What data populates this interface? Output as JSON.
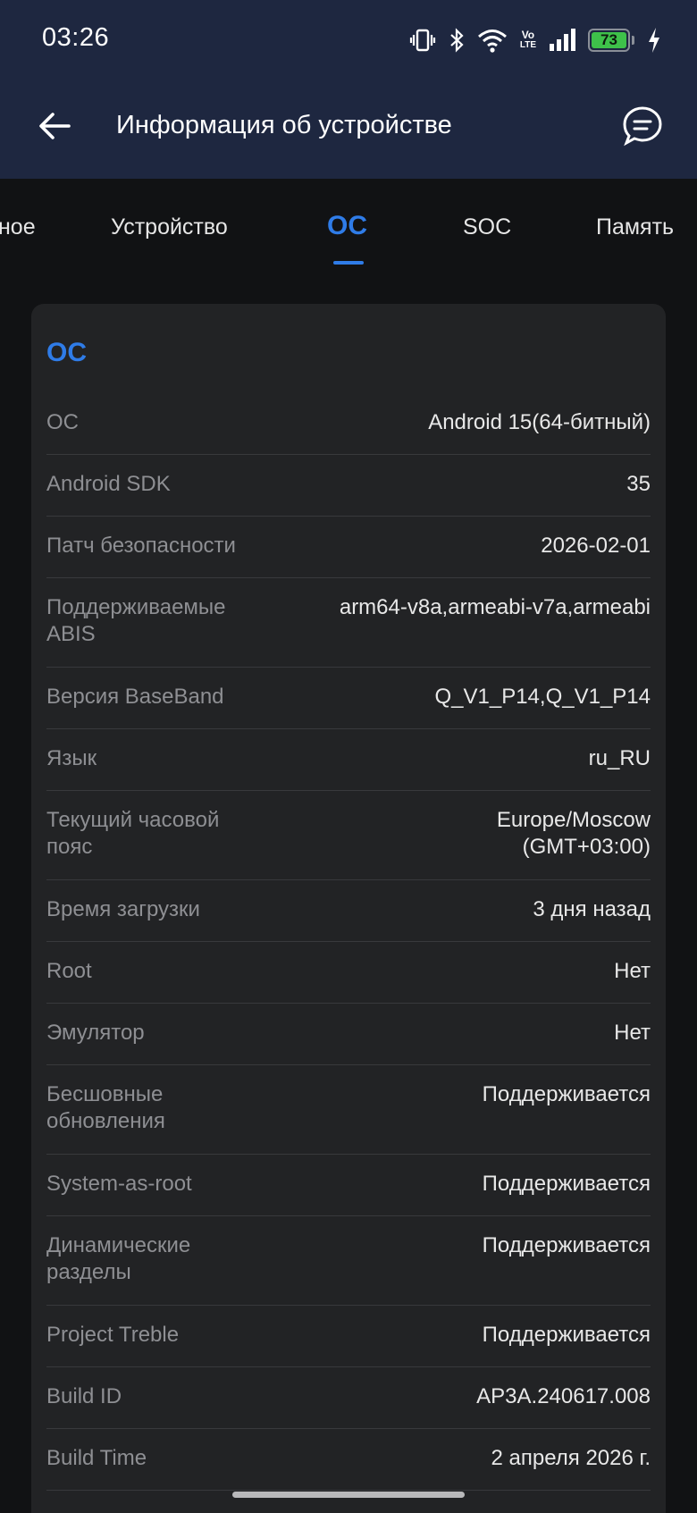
{
  "status_bar": {
    "time": "03:26",
    "battery_level": "73",
    "network_label_top": "Vo",
    "network_label_bottom": "LTE",
    "icons": [
      "vibrate-icon",
      "bluetooth-icon",
      "wifi-icon",
      "volte-icon",
      "signal-icon",
      "battery-icon",
      "charging-icon"
    ]
  },
  "header": {
    "title": "Информация об устройстве",
    "back_icon": "arrow-left-icon",
    "feedback_icon": "chat-bubble-icon"
  },
  "tabs": [
    {
      "label": "ное",
      "active": false
    },
    {
      "label": "Устройство",
      "active": false
    },
    {
      "label": "OC",
      "active": true
    },
    {
      "label": "SOC",
      "active": false
    },
    {
      "label": "Память",
      "active": false
    }
  ],
  "card": {
    "title": "OC",
    "rows": [
      {
        "label": "OC",
        "value": "Android 15(64-битный)"
      },
      {
        "label": "Android SDK",
        "value": "35"
      },
      {
        "label": "Патч безопасности",
        "value": "2026-02-01"
      },
      {
        "label": "Поддерживаемые ABIS",
        "value": "arm64-v8a,armeabi-v7a,armeabi"
      },
      {
        "label": "Версия BaseBand",
        "value": "Q_V1_P14,Q_V1_P14"
      },
      {
        "label": "Язык",
        "value": "ru_RU"
      },
      {
        "label": "Текущий часовой пояс",
        "value": "Europe/Moscow (GMT+03:00)"
      },
      {
        "label": "Время загрузки",
        "value": "3 дня назад"
      },
      {
        "label": "Root",
        "value": "Нет"
      },
      {
        "label": "Эмулятор",
        "value": "Нет"
      },
      {
        "label": "Бесшовные обновления",
        "value": "Поддерживается"
      },
      {
        "label": "System-as-root",
        "value": "Поддерживается"
      },
      {
        "label": "Динамические разделы",
        "value": "Поддерживается"
      },
      {
        "label": "Project Treble",
        "value": "Поддерживается"
      },
      {
        "label": "Build ID",
        "value": "AP3A.240617.008"
      },
      {
        "label": "Build Time",
        "value": "2 апреля 2026 г."
      }
    ]
  },
  "colors": {
    "accent": "#2f7ce8",
    "header_bg": "#1e2740",
    "card_bg": "#222325",
    "page_bg": "#111214"
  }
}
